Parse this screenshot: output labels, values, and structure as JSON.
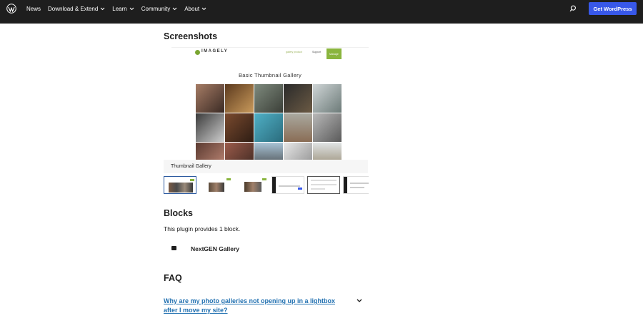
{
  "header": {
    "nav": [
      {
        "label": "News",
        "has_dropdown": false
      },
      {
        "label": "Download & Extend",
        "has_dropdown": true
      },
      {
        "label": "Learn",
        "has_dropdown": true
      },
      {
        "label": "Community",
        "has_dropdown": true
      },
      {
        "label": "About",
        "has_dropdown": true
      }
    ],
    "cta_label": "Get WordPress",
    "icons": {
      "logo": "wordpress-logo-icon",
      "search": "search-icon"
    },
    "colors": {
      "bar": "#1e1e1e",
      "cta": "#3858e9"
    }
  },
  "screenshots": {
    "heading": "Screenshots",
    "preview": {
      "brand": "IMAGELY",
      "nav_link_1": "gallery product",
      "nav_link_2": "Support",
      "button": "Manage",
      "gallery_title": "Basic Thumbnail Gallery"
    },
    "caption": "Thumbnail Gallery",
    "thumbnail_count": 6,
    "active_thumbnail": 1
  },
  "blocks": {
    "heading": "Blocks",
    "description": "This plugin provides 1 block.",
    "items": [
      {
        "name": "NextGEN Gallery",
        "icon": "camera-block-icon"
      }
    ]
  },
  "faq": {
    "heading": "FAQ",
    "questions": [
      {
        "text": "Why are my photo galleries not opening up in a lightbox after I move my site?",
        "icon": "chevron-down-icon"
      }
    ]
  },
  "colors": {
    "link": "#2271b1",
    "accent_green": "#8ab53e"
  }
}
